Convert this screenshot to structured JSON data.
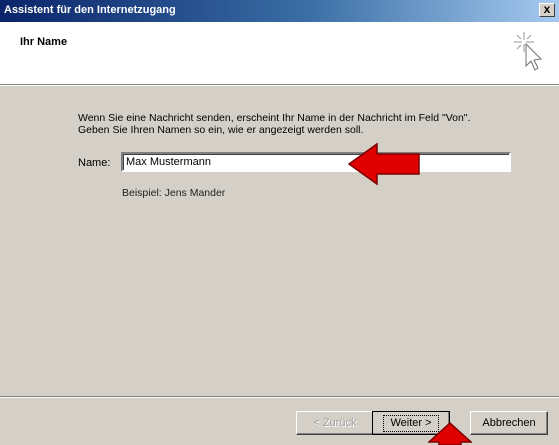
{
  "window": {
    "title": "Assistent für den Internetzugang",
    "close_label": "x"
  },
  "header": {
    "title": "Ihr Name",
    "icon": "wizard-cursor-sparkle-icon"
  },
  "content": {
    "description_line1": "Wenn Sie eine Nachricht senden, erscheint Ihr Name in der Nachricht im Feld \"Von\".",
    "description_line2": "Geben Sie Ihren Namen so ein, wie er angezeigt werden soll.",
    "name_label": "Name:",
    "name_value": "Max Mustermann",
    "example_text": "Beispiel: Jens Mander"
  },
  "buttons": {
    "back_label": "< Zurück",
    "next_label": "Weiter >",
    "cancel_label": "Abbrechen"
  },
  "annotations": {
    "arrow_color": "#e00000"
  }
}
